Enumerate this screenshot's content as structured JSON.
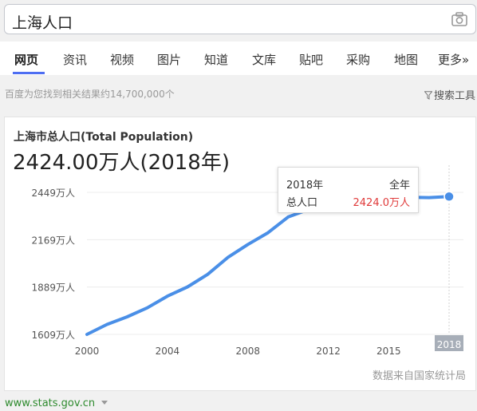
{
  "search": {
    "query": "上海人口"
  },
  "tabs": [
    {
      "label": "网页",
      "active": true
    },
    {
      "label": "资讯"
    },
    {
      "label": "视频"
    },
    {
      "label": "图片"
    },
    {
      "label": "知道"
    },
    {
      "label": "文库"
    },
    {
      "label": "贴吧"
    },
    {
      "label": "采购"
    },
    {
      "label": "地图"
    },
    {
      "label": "更多»"
    }
  ],
  "results_info": "百度为您找到相关结果约14,700,000个",
  "search_tools_label": "搜索工具",
  "card": {
    "title": "上海市总人口(Total Population)",
    "value": "2424.00万人(2018年)",
    "source": "数据来自国家统计局",
    "tooltip": {
      "year": "2018年",
      "period": "全年",
      "metric": "总人口",
      "value": "2424.0万人"
    }
  },
  "chart_data": {
    "type": "line",
    "x": [
      2000,
      2001,
      2002,
      2003,
      2004,
      2005,
      2006,
      2007,
      2008,
      2009,
      2010,
      2011,
      2012,
      2013,
      2014,
      2015,
      2016,
      2017,
      2018
    ],
    "series": [
      {
        "values": [
          1609,
          1668,
          1713,
          1766,
          1835,
          1890,
          1964,
          2064,
          2141,
          2210,
          2303,
          2347,
          2380,
          2415,
          2426,
          2415,
          2420,
          2418,
          2424
        ]
      }
    ],
    "x_ticks": [
      "2000",
      "2004",
      "2008",
      "2012",
      "2015",
      "2018"
    ],
    "x_tick_values": [
      2000,
      2004,
      2008,
      2012,
      2015,
      2018
    ],
    "y_ticks": [
      "1609万人",
      "1889万人",
      "2169万人",
      "2449万人"
    ],
    "y_tick_values": [
      1609,
      1889,
      2169,
      2449
    ],
    "ylim": [
      1609,
      2449
    ],
    "xlim": [
      2000,
      2018
    ],
    "highlight_index": 18,
    "grid": true,
    "line_color": "#4a8fe7"
  },
  "footer_link": "www.stats.gov.cn"
}
